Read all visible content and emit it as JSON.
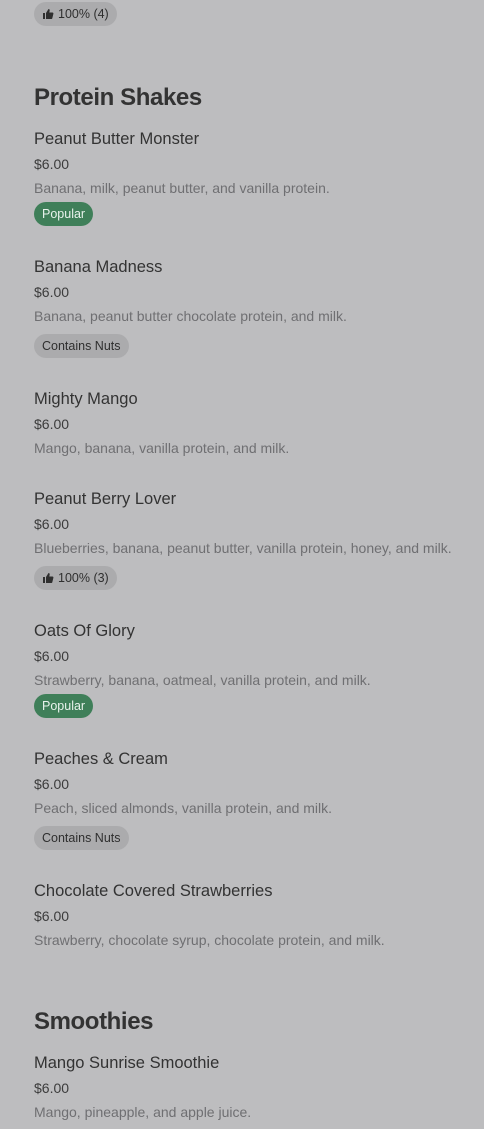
{
  "top_rating": {
    "label": "100% (4)"
  },
  "sections": [
    {
      "title": "Protein Shakes",
      "items": [
        {
          "name": "Peanut Butter Monster",
          "price": "$6.00",
          "desc": "Banana, milk, peanut butter, and vanilla protein.",
          "badge": "Popular"
        },
        {
          "name": "Banana Madness",
          "price": "$6.00",
          "desc": "Banana, peanut butter chocolate protein, and milk.",
          "badge": "Contains Nuts"
        },
        {
          "name": "Mighty Mango",
          "price": "$6.00",
          "desc": "Mango, banana, vanilla protein, and milk."
        },
        {
          "name": "Peanut Berry Lover",
          "price": "$6.00",
          "desc": "Blueberries, banana, peanut butter, vanilla protein, honey, and milk.",
          "rating": "100% (3)"
        },
        {
          "name": "Oats Of Glory",
          "price": "$6.00",
          "desc": "Strawberry, banana, oatmeal, vanilla protein, and milk.",
          "badge": "Popular"
        },
        {
          "name": "Peaches & Cream",
          "price": "$6.00",
          "desc": "Peach, sliced almonds, vanilla protein, and milk.",
          "badge": "Contains Nuts"
        },
        {
          "name": "Chocolate Covered Strawberries",
          "price": "$6.00",
          "desc": "Strawberry, chocolate syrup, chocolate protein, and milk."
        }
      ]
    },
    {
      "title": "Smoothies",
      "items": [
        {
          "name": "Mango Sunrise Smoothie",
          "price": "$6.00",
          "desc": "Mango, pineapple, and apple juice."
        }
      ]
    }
  ],
  "colors": {
    "background": "#bdbdbf",
    "popular_badge": "#3f7f59",
    "neutral_badge": "#ababad"
  },
  "icons": {
    "rating": "thumbs-up-icon"
  }
}
